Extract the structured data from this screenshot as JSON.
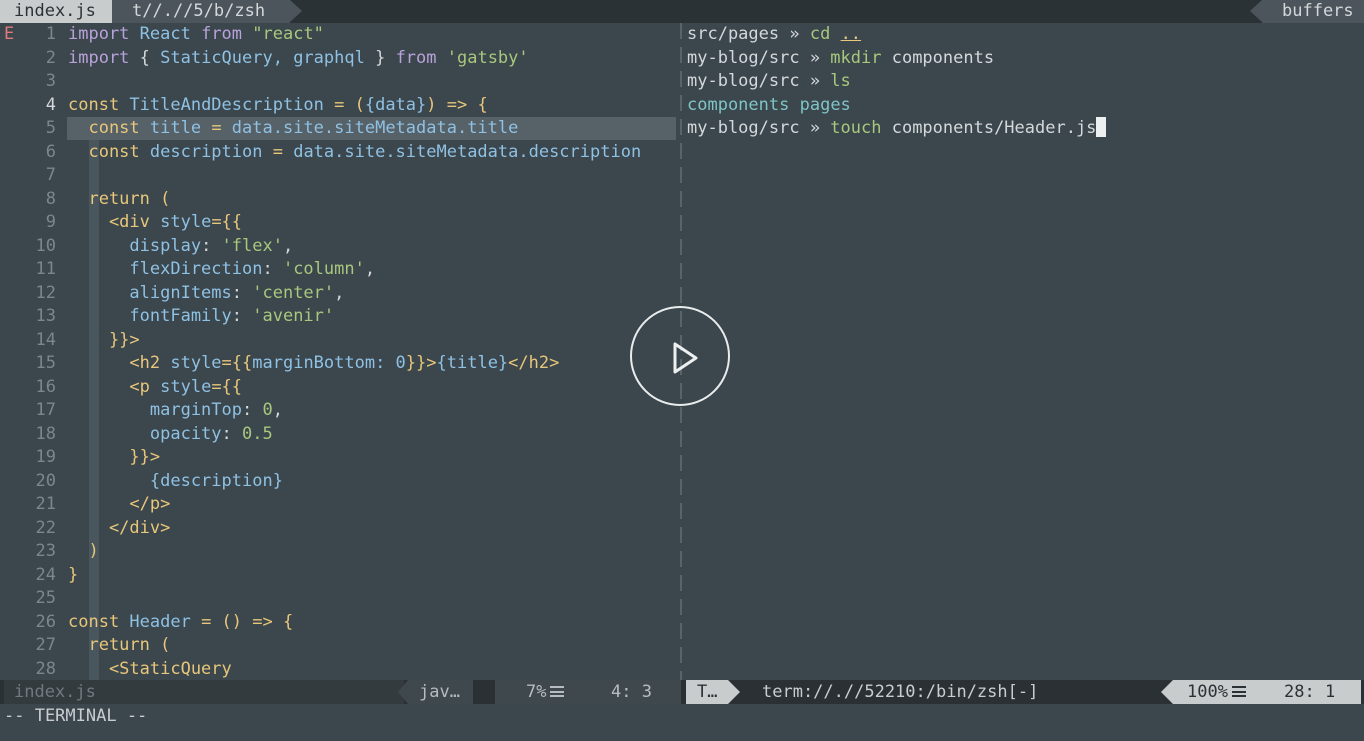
{
  "tabline": {
    "active_tab": "index.js",
    "inactive_tab": "t//.//5/b/zsh",
    "buffers_label": "buffers"
  },
  "editor": {
    "sign": "E",
    "lines": [
      {
        "num": "1",
        "parts": [
          {
            "t": "import",
            "c": "k"
          },
          {
            "t": " React ",
            "c": "f"
          },
          {
            "t": "from",
            "c": "k"
          },
          {
            "t": " \"react\"",
            "c": "s"
          }
        ]
      },
      {
        "num": "2",
        "parts": [
          {
            "t": "import",
            "c": "k"
          },
          {
            "t": " { ",
            "c": "d"
          },
          {
            "t": "StaticQuery, graphql",
            "c": "f"
          },
          {
            "t": " } ",
            "c": "d"
          },
          {
            "t": "from",
            "c": "k"
          },
          {
            "t": " 'gatsby'",
            "c": "s"
          }
        ]
      },
      {
        "num": "3",
        "parts": []
      },
      {
        "num": "4",
        "current": true,
        "parts": [
          {
            "t": "const",
            "c": "y"
          },
          {
            "t": " TitleAndDescription ",
            "c": "f"
          },
          {
            "t": "= (",
            "c": "y"
          },
          {
            "t": "{data}",
            "c": "f"
          },
          {
            "t": ") => {",
            "c": "y"
          }
        ]
      },
      {
        "num": "5",
        "parts": [
          {
            "t": "  const",
            "c": "y"
          },
          {
            "t": " title ",
            "c": "f"
          },
          {
            "t": "= ",
            "c": "y"
          },
          {
            "t": "data.site.siteMetadata.title",
            "c": "f"
          }
        ]
      },
      {
        "num": "6",
        "parts": [
          {
            "t": "  const",
            "c": "y"
          },
          {
            "t": " description ",
            "c": "f"
          },
          {
            "t": "= ",
            "c": "y"
          },
          {
            "t": "data.site.siteMetadata.description",
            "c": "f"
          }
        ]
      },
      {
        "num": "7",
        "parts": []
      },
      {
        "num": "8",
        "parts": [
          {
            "t": "  return (",
            "c": "y"
          }
        ]
      },
      {
        "num": "9",
        "parts": [
          {
            "t": "    <div ",
            "c": "y"
          },
          {
            "t": "style",
            "c": "f"
          },
          {
            "t": "={{",
            "c": "y"
          }
        ]
      },
      {
        "num": "10",
        "parts": [
          {
            "t": "      display",
            "c": "f"
          },
          {
            "t": ": ",
            "c": "d"
          },
          {
            "t": "'flex'",
            "c": "s"
          },
          {
            "t": ",",
            "c": "d"
          }
        ]
      },
      {
        "num": "11",
        "parts": [
          {
            "t": "      flexDirection",
            "c": "f"
          },
          {
            "t": ": ",
            "c": "d"
          },
          {
            "t": "'column'",
            "c": "s"
          },
          {
            "t": ",",
            "c": "d"
          }
        ]
      },
      {
        "num": "12",
        "parts": [
          {
            "t": "      alignItems",
            "c": "f"
          },
          {
            "t": ": ",
            "c": "d"
          },
          {
            "t": "'center'",
            "c": "s"
          },
          {
            "t": ",",
            "c": "d"
          }
        ]
      },
      {
        "num": "13",
        "parts": [
          {
            "t": "      fontFamily",
            "c": "f"
          },
          {
            "t": ": ",
            "c": "d"
          },
          {
            "t": "'avenir'",
            "c": "s"
          }
        ]
      },
      {
        "num": "14",
        "parts": [
          {
            "t": "    }}>",
            "c": "y"
          }
        ]
      },
      {
        "num": "15",
        "parts": [
          {
            "t": "      <h2 ",
            "c": "y"
          },
          {
            "t": "style",
            "c": "f"
          },
          {
            "t": "={{",
            "c": "y"
          },
          {
            "t": "marginBottom: 0",
            "c": "f"
          },
          {
            "t": "}}>",
            "c": "y"
          },
          {
            "t": "{title}",
            "c": "f"
          },
          {
            "t": "</h2>",
            "c": "y"
          }
        ]
      },
      {
        "num": "16",
        "parts": [
          {
            "t": "      <p ",
            "c": "y"
          },
          {
            "t": "style",
            "c": "f"
          },
          {
            "t": "={{",
            "c": "y"
          }
        ]
      },
      {
        "num": "17",
        "parts": [
          {
            "t": "        marginTop",
            "c": "f"
          },
          {
            "t": ": ",
            "c": "d"
          },
          {
            "t": "0",
            "c": "s"
          },
          {
            "t": ",",
            "c": "d"
          }
        ]
      },
      {
        "num": "18",
        "parts": [
          {
            "t": "        opacity",
            "c": "f"
          },
          {
            "t": ": ",
            "c": "d"
          },
          {
            "t": "0.5",
            "c": "s"
          }
        ]
      },
      {
        "num": "19",
        "parts": [
          {
            "t": "      }}>",
            "c": "y"
          }
        ]
      },
      {
        "num": "20",
        "parts": [
          {
            "t": "        {description}",
            "c": "f"
          }
        ]
      },
      {
        "num": "21",
        "parts": [
          {
            "t": "      </p>",
            "c": "y"
          }
        ]
      },
      {
        "num": "22",
        "parts": [
          {
            "t": "    </div>",
            "c": "y"
          }
        ]
      },
      {
        "num": "23",
        "parts": [
          {
            "t": "  )",
            "c": "y"
          }
        ]
      },
      {
        "num": "24",
        "parts": [
          {
            "t": "}",
            "c": "y"
          }
        ]
      },
      {
        "num": "25",
        "parts": []
      },
      {
        "num": "26",
        "parts": [
          {
            "t": "const",
            "c": "y"
          },
          {
            "t": " Header ",
            "c": "f"
          },
          {
            "t": "= () => {",
            "c": "y"
          }
        ]
      },
      {
        "num": "27",
        "parts": [
          {
            "t": "  return (",
            "c": "y"
          }
        ]
      },
      {
        "num": "28",
        "parts": [
          {
            "t": "    <StaticQuery",
            "c": "y"
          }
        ]
      }
    ]
  },
  "terminal": {
    "lines": [
      {
        "parts": [
          {
            "t": "src/pages » ",
            "c": "d"
          },
          {
            "t": "cd",
            "c": "s"
          },
          {
            "t": " ",
            "c": "d"
          },
          {
            "t": "..",
            "c": "y",
            "u": true
          }
        ]
      },
      {
        "parts": [
          {
            "t": "my-blog/src » ",
            "c": "d"
          },
          {
            "t": "mkdir",
            "c": "s"
          },
          {
            "t": " components",
            "c": "d"
          }
        ]
      },
      {
        "parts": [
          {
            "t": "my-blog/src » ",
            "c": "d"
          },
          {
            "t": "ls",
            "c": "s"
          }
        ]
      },
      {
        "parts": [
          {
            "t": "components",
            "c": "o"
          },
          {
            "t": " ",
            "c": "d"
          },
          {
            "t": "pages",
            "c": "o"
          }
        ]
      },
      {
        "parts": [
          {
            "t": "my-blog/src » ",
            "c": "d"
          },
          {
            "t": "touch",
            "c": "s"
          },
          {
            "t": " components/Header.js",
            "c": "d"
          }
        ],
        "cursor": true
      }
    ]
  },
  "statusline": {
    "left_filename": "index.js",
    "filetype": "jav…",
    "left_percent": "7%",
    "left_position": "4:  3",
    "mode": "T…",
    "term_name": "term://.//52210:/bin/zsh[-]",
    "right_percent": "100%",
    "right_position": "28:  1"
  },
  "cmdline": "-- TERMINAL --",
  "overlay": {
    "icon": "play-icon"
  }
}
